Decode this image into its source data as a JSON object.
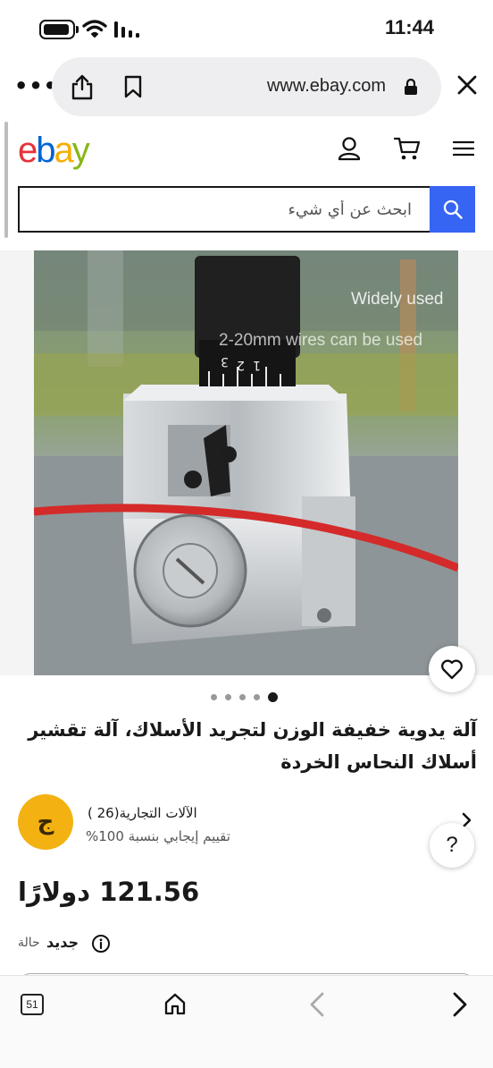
{
  "status_bar": {
    "time": "11:44"
  },
  "browser": {
    "url": "www.ebay.com"
  },
  "header": {
    "logo": [
      "e",
      "b",
      "a",
      "y"
    ]
  },
  "search": {
    "placeholder": "ابحث عن أي شيء"
  },
  "product": {
    "image_overlay": [
      "Widely used",
      "2-20mm wires can be used"
    ],
    "image_count": 5,
    "active_image": 5,
    "title": "آلة يدوية خفيفة الوزن لتجريد الأسلاك، آلة تقشير أسلاك النحاس الخردة",
    "price": "121.56 دولارًا",
    "condition_label": "حالة",
    "condition_value": "جديد"
  },
  "seller": {
    "avatar_letter": "ج",
    "name": "الآلات التجارية",
    "feedback_count": "(26 )",
    "feedback": "تقييم إيجابي بنسبة 100%"
  },
  "help_button": "?",
  "toolbar": {
    "tab_count": "51"
  },
  "colors": {
    "accent": "#3665f3",
    "avatar": "#f3b212"
  }
}
